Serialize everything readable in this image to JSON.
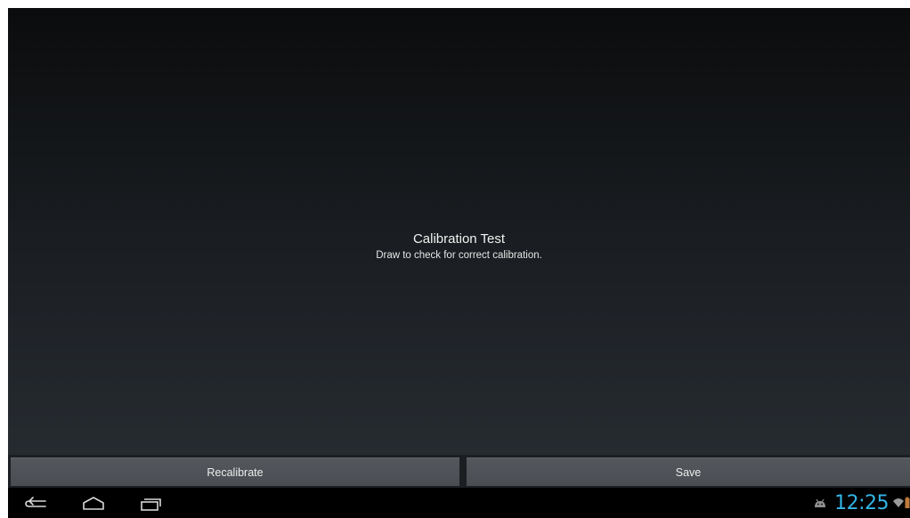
{
  "calibration": {
    "title": "Calibration Test",
    "subtitle": "Draw to check for correct calibration."
  },
  "buttons": {
    "recalibrate_label": "Recalibrate",
    "save_label": "Save"
  },
  "system_bar": {
    "back_icon": "back-icon",
    "home_icon": "home-icon",
    "recents_icon": "recent-apps-icon",
    "notification_icon": "android-debug-icon",
    "clock": "12:25",
    "wifi_icon": "wifi-icon",
    "battery_icon": "battery-icon",
    "accent_color": "#33b5e5"
  }
}
